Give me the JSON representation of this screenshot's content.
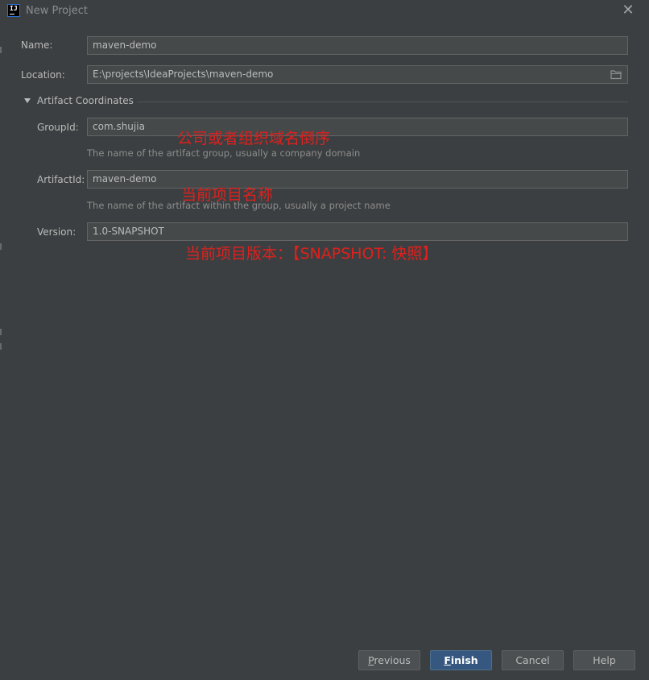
{
  "window": {
    "title": "New Project",
    "app_icon_text": "IJ"
  },
  "form": {
    "name": {
      "label": "Name:",
      "value": "maven-demo"
    },
    "location": {
      "label": "Location:",
      "value": "E:\\projects\\IdeaProjects\\maven-demo"
    },
    "section": {
      "title": "Artifact Coordinates",
      "expanded": true
    },
    "groupid": {
      "label": "GroupId:",
      "value": "com.shujia",
      "hint": "The name of the artifact group, usually a company domain"
    },
    "artifactid": {
      "label": "ArtifactId:",
      "value": "maven-demo",
      "hint": "The name of the artifact within the group, usually a project name"
    },
    "version": {
      "label": "Version:",
      "value": "1.0-SNAPSHOT"
    }
  },
  "annotations": {
    "groupid": "公司或者组织域名倒序",
    "artifactid": "当前项目名称",
    "version": "当前项目版本：【SNAPSHOT: 快照】"
  },
  "buttons": {
    "previous": {
      "first": "P",
      "rest": "revious"
    },
    "finish": {
      "first": "F",
      "rest": "inish"
    },
    "cancel": "Cancel",
    "help": "Help"
  },
  "colors": {
    "background": "#3c3f41",
    "field_bg": "#45494a",
    "primary_button": "#365880",
    "annotation": "#e0201d"
  },
  "icons": [
    "close-icon",
    "folder-icon",
    "expand-triangle-icon",
    "intellij-app-icon"
  ]
}
